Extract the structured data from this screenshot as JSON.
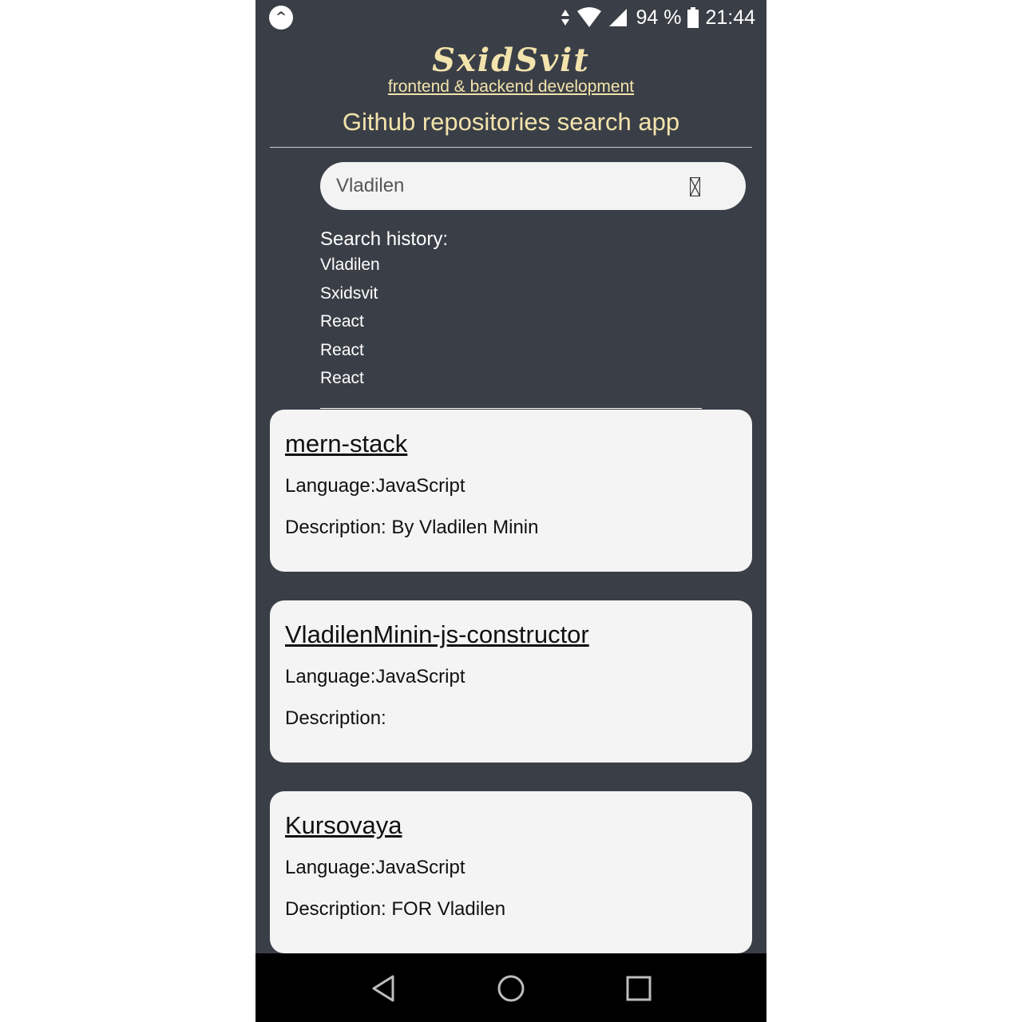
{
  "status_bar": {
    "app_badge_glyph": "^",
    "battery_percent": "94 %",
    "time": "21:44",
    "icons": [
      "data-arrows-icon",
      "wifi-icon",
      "signal-icon",
      "battery-icon"
    ]
  },
  "header": {
    "brand": "SxidSvit",
    "tagline": "frontend & backend development",
    "title": "Github repositories search app"
  },
  "search": {
    "value": "Vladilen",
    "icon": "search-icon"
  },
  "history": {
    "title": "Search history:",
    "items": [
      "Vladilen",
      "Sxidsvit",
      "React",
      "React",
      "React"
    ]
  },
  "repos": [
    {
      "name": "mern-stack",
      "language": "Language:JavaScript",
      "description": "Description: By Vladilen Minin"
    },
    {
      "name": "VladilenMinin-js-constructor",
      "language": "Language:JavaScript",
      "description": "Description:"
    },
    {
      "name": "Kursovaya",
      "language": "Language:JavaScript",
      "description": "Description: FOR Vladilen"
    }
  ],
  "nav": {
    "icons": [
      "back-icon",
      "home-icon",
      "recents-icon"
    ]
  },
  "colors": {
    "background": "#3a3f47",
    "accent": "#f3e3ac",
    "card": "#f4f4f4",
    "nav_bar": "#000000"
  }
}
